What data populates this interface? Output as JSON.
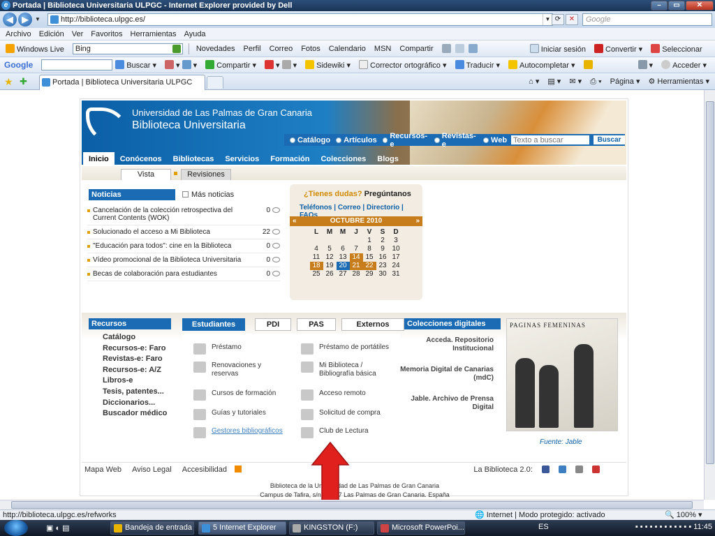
{
  "window": {
    "title": "Portada | Biblioteca Universitaria ULPGC - Internet Explorer provided by Dell"
  },
  "address": {
    "url": "http://biblioteca.ulpgc.es/",
    "search_placeholder": "Google"
  },
  "menu": [
    "Archivo",
    "Edición",
    "Ver",
    "Favoritos",
    "Herramientas",
    "Ayuda"
  ],
  "windows_live": {
    "label": "Windows Live",
    "search_value": "Bing",
    "links": [
      "Novedades",
      "Perfil",
      "Correo",
      "Fotos",
      "Calendario",
      "MSN",
      "Compartir"
    ],
    "signin": "Iniciar sesión",
    "convert": "Convertir",
    "select": "Seleccionar"
  },
  "google_bar": {
    "logo": "Google",
    "items": [
      "Buscar",
      "Compartir",
      "Sidewiki",
      "Corrector ortográfico",
      "Traducir",
      "Autocompletar"
    ],
    "signin": "Acceder"
  },
  "tab": {
    "label": "Portada | Biblioteca Universitaria ULPGC",
    "right_tools": [
      "Página",
      "Herramientas"
    ]
  },
  "banner": {
    "univ": "Universidad de Las Palmas de Gran Canaria",
    "biblioteca": "Biblioteca Universitaria"
  },
  "search": {
    "options": [
      "Catálogo",
      "Artículos",
      "Recursos-e",
      "Revistas-e",
      "Web"
    ],
    "placeholder": "Texto a buscar",
    "button": "Buscar"
  },
  "mainnav": [
    "Inicio",
    "Conócenos",
    "Bibliotecas",
    "Servicios",
    "Formación",
    "Colecciones",
    "Blogs"
  ],
  "subtabs": [
    "Vista",
    "Revisiones"
  ],
  "noticias": {
    "title": "Noticias",
    "more": "Más noticias",
    "items": [
      {
        "text": "Cancelación de la colección retrospectiva del Current Contents (WOK)",
        "count": "0"
      },
      {
        "text": "Solucionado el acceso a Mi Biblioteca",
        "count": "22"
      },
      {
        "text": "\"Educación para todos\": cine en la Biblioteca",
        "count": "0"
      },
      {
        "text": "Vídeo promocional de la Biblioteca Universitaria",
        "count": "0"
      },
      {
        "text": "Becas de colaboración para estudiantes",
        "count": "0"
      }
    ]
  },
  "dudas": {
    "q": "¿Tienes dudas?",
    "a": "Pregúntanos",
    "links": [
      "Teléfonos",
      "Correo",
      "Directorio",
      "FAQs"
    ]
  },
  "calendar": {
    "month": "OCTUBRE 2010",
    "days": [
      "L",
      "M",
      "M",
      "J",
      "V",
      "S",
      "D"
    ],
    "cells": [
      "",
      "",
      "",
      "",
      "1",
      "2",
      "3",
      "4",
      "5",
      "6",
      "7",
      "8",
      "9",
      "10",
      "11",
      "12",
      "13",
      "14",
      "15",
      "16",
      "17",
      "18",
      "19",
      "20",
      "21",
      "22",
      "23",
      "24",
      "25",
      "26",
      "27",
      "28",
      "29",
      "30",
      "31"
    ],
    "event_days": [
      "14",
      "18",
      "21",
      "22"
    ],
    "today": "20"
  },
  "recursos": {
    "title": "Recursos",
    "items": [
      "Catálogo",
      "Recursos-e: Faro",
      "Revistas-e: Faro",
      "Recursos-e: A/Z",
      "Libros-e",
      "Tesis, patentes...",
      "Diccionarios...",
      "Buscador médico"
    ]
  },
  "ctabs": [
    "Estudiantes",
    "PDI",
    "PAS",
    "Externos"
  ],
  "services": [
    [
      "Préstamo",
      "Préstamo de portátiles"
    ],
    [
      "Renovaciones y reservas",
      "Mi Biblioteca / Bibliografía básica"
    ],
    [
      "Cursos de formación",
      "Acceso remoto"
    ],
    [
      "Guías y tutoriales",
      "Solicitud de compra"
    ],
    [
      "Gestores bibliográficos",
      "Club de Lectura"
    ]
  ],
  "colecciones": {
    "title": "Colecciones digitales",
    "items": [
      "Acceda. Repositorio Institucional",
      "Memoria Digital de Canarias (mdC)",
      "Jable. Archivo de Prensa Digital"
    ],
    "image_title": "PAGINAS FEMENINAS",
    "fuente_label": "Fuente:",
    "fuente_value": "Jable"
  },
  "footer": {
    "links": [
      "Mapa Web",
      "Aviso Legal",
      "Accesibilidad"
    ],
    "social_label": "La Biblioteca 2.0:",
    "addr1": "Biblioteca de la Universidad de Las Palmas de Gran Canaria",
    "addr2": "Campus de Tafira, s/n. 35017 Las Palmas de Gran Canaria. España"
  },
  "status": {
    "url": "http://biblioteca.ulpgc.es/refworks",
    "zone": "Internet | Modo protegido: activado",
    "zoom": "100%"
  },
  "taskbar": {
    "tasks": [
      "Bandeja de entrada ...",
      "5 Internet Explorer",
      "KINGSTON (F:)",
      "Microsoft PowerPoi..."
    ],
    "lang": "ES",
    "clock": "11:45"
  },
  "colors": {
    "ie_blue": "#1a6bb4",
    "accent_orange": "#c77d1b",
    "arrow_red": "#e0201c"
  }
}
